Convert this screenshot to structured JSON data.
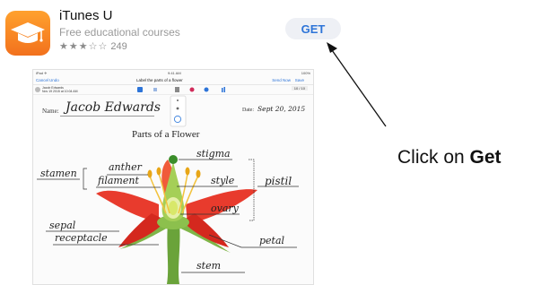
{
  "app": {
    "name": "iTunes U",
    "subtitle": "Free educational courses",
    "stars": "★★★☆☆",
    "rating_count": "249",
    "get_label": "GET",
    "icon": "graduation-cap-icon",
    "accent_color": "#2d74d8",
    "icon_color": "#f27b1f"
  },
  "screenshot": {
    "status_left": "iPad ✈",
    "status_center": "9:41 AM",
    "status_right": "100%",
    "nav_cancel": "Cancel",
    "nav_undo": "Undo",
    "nav_title": "Label the parts of a flower",
    "nav_send": "Send Now",
    "nav_save": "Save",
    "author_name": "Jacob Edwards",
    "author_date": "Nov 19 2015 at 10:04 AM",
    "page_indicator": "10 / 10",
    "worksheet": {
      "name_label": "Name:",
      "name_value": "Jacob Edwards",
      "date_label": "Date:",
      "date_value": "Sept 20, 2015",
      "title": "Parts of a Flower",
      "labels": {
        "stigma": "stigma",
        "anther": "anther",
        "stamen": "stamen",
        "filament": "filament",
        "style": "style",
        "pistil": "pistil",
        "ovary": "ovary",
        "sepal": "sepal",
        "receptacle": "receptacle",
        "petal": "petal",
        "stem": "stem"
      }
    }
  },
  "annotation": {
    "prefix": "Click on ",
    "emphasis": "Get"
  }
}
